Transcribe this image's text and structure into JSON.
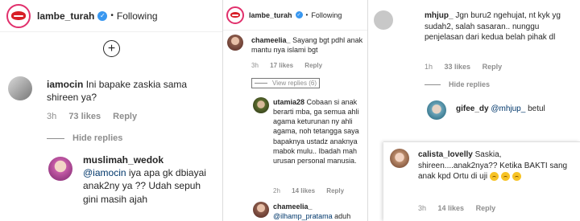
{
  "account": {
    "name": "lambe_turah",
    "follow_label": "Following",
    "dot": "•"
  },
  "add_label": "+",
  "hide_replies": "Hide replies",
  "reply_label": "Reply",
  "panel1": {
    "c1": {
      "user": "iamocin",
      "text": "Ini bapake zaskia sama shireen ya?",
      "time": "3h",
      "likes": "73 likes"
    },
    "c2": {
      "user": "muslimah_wedok",
      "mention": "@iamocin",
      "text": " iya apa gk dbiayai anak2ny ya ?? Udah sepuh gini masih ajah"
    }
  },
  "panel2": {
    "c1": {
      "user": "chameelia_",
      "text": "Sayang bgt pdhl anak mantu nya islami bgt",
      "time": "3h",
      "likes": "17 likes"
    },
    "view_replies": "View replies (6)",
    "c2": {
      "user": "utamia28",
      "text": "Cobaan si anak berarti mba, ga semua ahli agama keturunan ny ahli agama, noh tetangga saya bapaknya ustadz anaknya mabok mulu.. Ibadah mah urusan personal manusia.",
      "time": "2h",
      "likes": "14 likes"
    },
    "c3": {
      "user": "chameelia_",
      "mention": "@ilhamp_pratama",
      "text": " aduh"
    }
  },
  "panel3": {
    "c1": {
      "user": "mhjup_",
      "text": "Jgn buru2 ngehujat, nt kyk yg sudah2, salah sasaran.. nunggu penjelasan dari kedua belah pihak dl",
      "time": "1h",
      "likes": "33 likes"
    },
    "c2": {
      "user": "gifee_dy",
      "mention": "@mhjup_",
      "text": " betul"
    },
    "c3": {
      "user": "calista_lovelly",
      "text": "Saskia, shireen....anak2nya?? Ketika BAKTI sang anak kpd Ortu di uji",
      "time": "3h",
      "likes": "14 likes"
    }
  },
  "colors": {
    "verified": "#3897f0",
    "mention": "#00376b",
    "meta": "#8e8e8e",
    "ring": "#e1306c"
  }
}
